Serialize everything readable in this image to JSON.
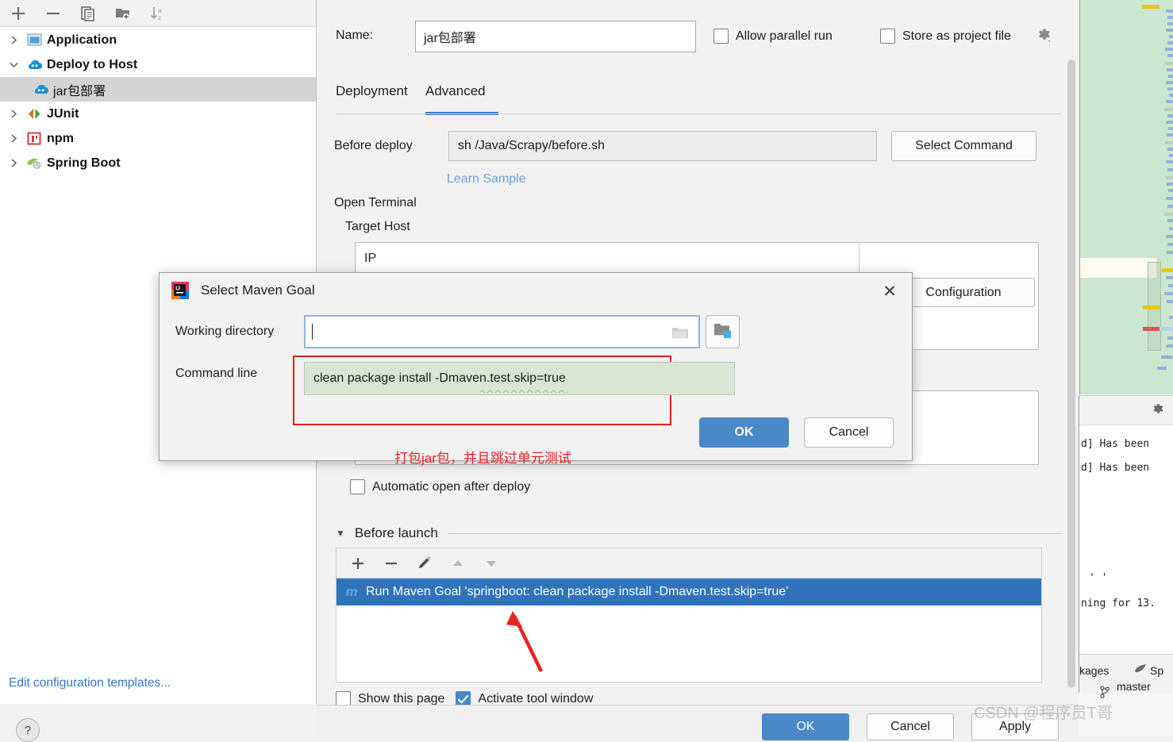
{
  "sidebar": {
    "toolbar": [
      {
        "name": "add-icon",
        "glyph": "+"
      },
      {
        "name": "remove-icon",
        "glyph": "−"
      },
      {
        "name": "copy-icon",
        "glyph": "copy"
      },
      {
        "name": "new-folder-icon",
        "glyph": "folder-add"
      },
      {
        "name": "sort-alphabetically-icon",
        "glyph": "sort-az"
      }
    ],
    "tree": [
      {
        "label": "Application",
        "icon": "application-icon",
        "expanded": false,
        "level": 0
      },
      {
        "label": "Deploy to Host",
        "icon": "cloud-icon",
        "expanded": true,
        "level": 0
      },
      {
        "label": "jar包部署",
        "icon": "cloud-icon",
        "level": 1,
        "selected": true
      },
      {
        "label": "JUnit",
        "icon": "junit-icon",
        "expanded": false,
        "level": 0
      },
      {
        "label": "npm",
        "icon": "npm-icon",
        "expanded": false,
        "level": 0
      },
      {
        "label": "Spring Boot",
        "icon": "spring-boot-icon",
        "expanded": false,
        "level": 0
      }
    ],
    "edit_templates_link": "Edit configuration templates...",
    "help_glyph": "?"
  },
  "main": {
    "name_label": "Name:",
    "name_value": "jar包部署",
    "allow_parallel_run": {
      "label": "Allow parallel run",
      "checked": false
    },
    "store_as_project_file": {
      "label": "Store as project file",
      "checked": false
    },
    "tabs": [
      {
        "label": "Deployment",
        "active": false
      },
      {
        "label": "Advanced",
        "active": true
      }
    ],
    "before_deploy_label": "Before deploy",
    "before_deploy_value": "sh /Java/Scrapy/before.sh",
    "select_command_button": "Select Command",
    "learn_sample_link": "Learn Sample",
    "open_terminal_label": "Open Terminal",
    "target_host_label": "Target Host",
    "host_table_header": "IP",
    "configuration_button": "Configuration",
    "automatic_open_after_deploy": {
      "label": "Automatic open after deploy",
      "checked": false
    },
    "before_launch": {
      "title": "Before launch",
      "collapse_glyph": "▼",
      "toolbar": [
        {
          "name": "add-task-icon",
          "glyph": "+"
        },
        {
          "name": "remove-task-icon",
          "glyph": "−"
        },
        {
          "name": "edit-task-icon",
          "glyph": "pencil"
        },
        {
          "name": "move-up-icon",
          "glyph": "▲"
        },
        {
          "name": "move-down-icon",
          "glyph": "▼"
        }
      ],
      "items": [
        {
          "label": "Run Maven Goal 'springboot: clean package install -Dmaven.test.skip=true'",
          "icon": "maven-icon",
          "selected": true
        }
      ]
    },
    "show_this_page": {
      "label": "Show this page",
      "checked": false
    },
    "activate_tool_window": {
      "label": "Activate tool window",
      "checked": true
    }
  },
  "bottom_buttons": {
    "ok": "OK",
    "cancel": "Cancel",
    "apply": "Apply"
  },
  "dialog": {
    "title": "Select Maven Goal",
    "icon": "intellij-idea-icon",
    "close_glyph": "✕",
    "working_directory_label": "Working directory",
    "working_directory_value": "",
    "working_directory_placeholder": "",
    "command_line_label": "Command line",
    "command_line_value": "clean package install -Dmaven.test.skip=true",
    "ok": "OK",
    "cancel": "Cancel"
  },
  "annotations": {
    "red_note": "打包jar包，并且跳过单元测试",
    "watermark": "CSDN @程序员T哥"
  },
  "console": {
    "lines": [
      "d] Has been",
      "d] Has been",
      "' '",
      "ning for 13."
    ]
  },
  "status_bar": {
    "packages_text": "kages",
    "spring_text": "Sp",
    "branch": "master"
  },
  "colors": {
    "accent_blue": "#4a88c7",
    "selection_blue": "#2f74bb",
    "tab_underline": "#3b7fc4",
    "link_blue": "#3574c9",
    "annotation_red": "#ee2222",
    "command_field_green": "#d6e8d2",
    "minimap_green": "#cce7cf"
  }
}
